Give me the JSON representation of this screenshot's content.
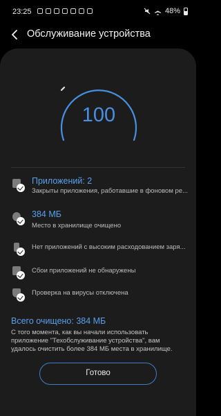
{
  "status_bar": {
    "time": "23:25",
    "notification_icons": [
      "sms-icon",
      "facebook-icon",
      "gallery-icon",
      "vk-icon",
      "instagram-icon",
      "image-icon",
      "twitter-icon"
    ],
    "right_icons": [
      "mute-icon",
      "airplane-icon"
    ],
    "battery": "48%"
  },
  "header": {
    "title": "Обслуживание устройства"
  },
  "gauge": {
    "value": "100",
    "level": 1.0,
    "accent_color": "#4a90e2"
  },
  "items": [
    {
      "title": "Приложений: 2",
      "subtitle": "Закрыты приложения, работавшие в фоновом ре..."
    },
    {
      "title": "384 МБ",
      "subtitle": "Место в хранилище очищено"
    },
    {
      "title": "",
      "subtitle": "Нет приложений с высоким расходованием заря..."
    },
    {
      "title": "",
      "subtitle": "Сбои приложений не обнаружены"
    },
    {
      "title": "",
      "subtitle": "Проверка на вирусы отключена"
    }
  ],
  "summary": {
    "total": "Всего очищено: 384 МБ",
    "description": "С того момента, как вы начали использовать приложение \"Техобслуживание устройства\", вам удалось очистить более 384 МБ места в хранилище."
  },
  "actions": {
    "done_label": "Готово"
  }
}
